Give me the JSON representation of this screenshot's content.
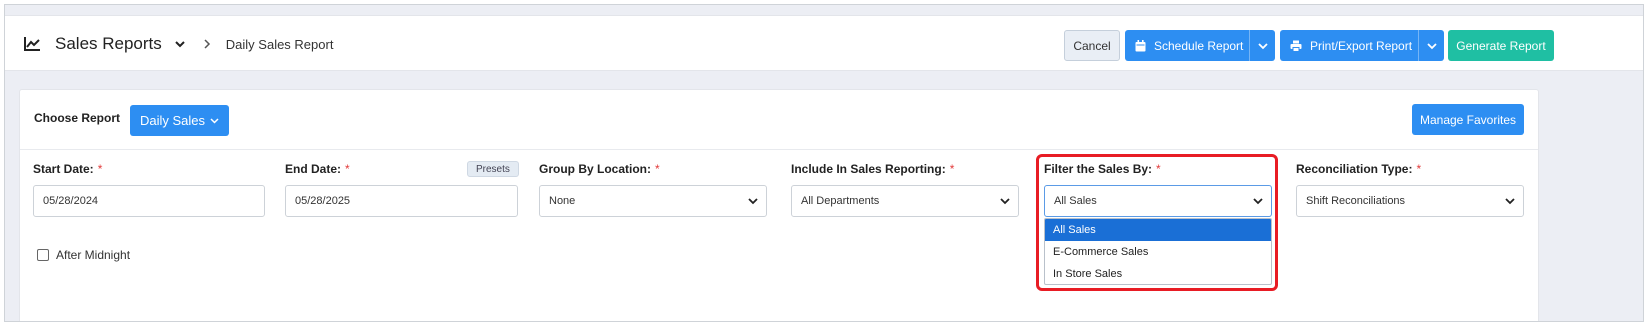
{
  "header": {
    "app_title": "Sales Reports",
    "breadcrumb": "Daily Sales Report",
    "cancel_label": "Cancel",
    "schedule_label": "Schedule Report",
    "print_label": "Print/Export Report",
    "generate_label": "Generate Report"
  },
  "report": {
    "choose_label": "Choose Report",
    "selected_report": "Daily Sales",
    "favorites_label": "Manage Favorites"
  },
  "filters": {
    "start_date": {
      "label": "Start Date:",
      "value": "05/28/2024"
    },
    "end_date": {
      "label": "End Date:",
      "value": "05/28/2025",
      "presets_label": "Presets"
    },
    "group_by": {
      "label": "Group By Location:",
      "value": "None"
    },
    "include": {
      "label": "Include In Sales Reporting:",
      "value": "All Departments"
    },
    "filter_by": {
      "label": "Filter the Sales By:",
      "value": "All Sales",
      "options": [
        "All Sales",
        "E-Commerce Sales",
        "In Store Sales"
      ]
    },
    "reconciliation": {
      "label": "Reconciliation Type:",
      "value": "Shift Reconciliations"
    },
    "required_marker": "*",
    "after_midnight_label": "After Midnight"
  },
  "colors": {
    "primary": "#2d8ef2",
    "success": "#1fbfa3",
    "highlight": "#e81c24",
    "selected_option": "#1a6fd6"
  },
  "icons": [
    "chart-line-icon",
    "chevron-down-icon",
    "chevron-right-icon",
    "calendar-icon",
    "printer-icon",
    "caret-down-icon"
  ]
}
